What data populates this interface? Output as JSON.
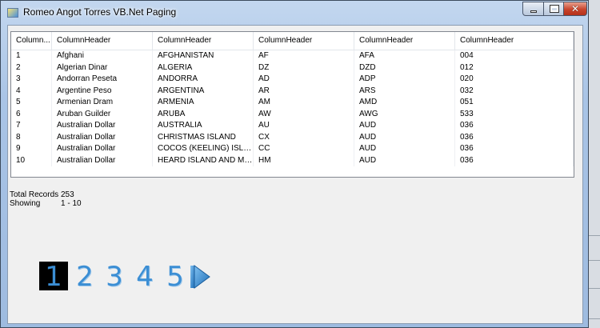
{
  "window": {
    "title": "Romeo Angot Torres VB.Net Paging",
    "close_glyph": "✕"
  },
  "listview": {
    "columns": [
      "Column...",
      "ColumnHeader",
      "ColumnHeader",
      "ColumnHeader",
      "ColumnHeader",
      "ColumnHeader"
    ],
    "rows": [
      [
        "1",
        "Afghani",
        "AFGHANISTAN",
        "AF",
        "AFA",
        "004"
      ],
      [
        "2",
        "Algerian Dinar",
        "ALGERIA",
        "DZ",
        "DZD",
        "012"
      ],
      [
        "3",
        "Andorran Peseta",
        "ANDORRA",
        "AD",
        "ADP",
        "020"
      ],
      [
        "4",
        "Argentine Peso",
        "ARGENTINA",
        "AR",
        "ARS",
        "032"
      ],
      [
        "5",
        "Armenian Dram",
        "ARMENIA",
        "AM",
        "AMD",
        "051"
      ],
      [
        "6",
        "Aruban Guilder",
        "ARUBA",
        "AW",
        "AWG",
        "533"
      ],
      [
        "7",
        "Australian Dollar",
        "AUSTRALIA",
        "AU",
        "AUD",
        "036"
      ],
      [
        "8",
        "Australian Dollar",
        "CHRISTMAS ISLAND",
        "CX",
        "AUD",
        "036"
      ],
      [
        "9",
        "Australian Dollar",
        "COCOS (KEELING) ISLAN...",
        "CC",
        "AUD",
        "036"
      ],
      [
        "10",
        "Australian Dollar",
        "HEARD ISLAND AND MC...",
        "HM",
        "AUD",
        "036"
      ]
    ]
  },
  "records": {
    "total_label": "Total Records",
    "total_value": "253",
    "showing_label": "Showing",
    "showing_value": "1 - 10"
  },
  "pager": {
    "pages": [
      "1",
      "2",
      "3",
      "4",
      "5"
    ],
    "active_page": "1",
    "next_icon": "play-arrow-icon"
  },
  "colors": {
    "page_link": "#3b8ed4",
    "active_page_bg": "#000000"
  }
}
